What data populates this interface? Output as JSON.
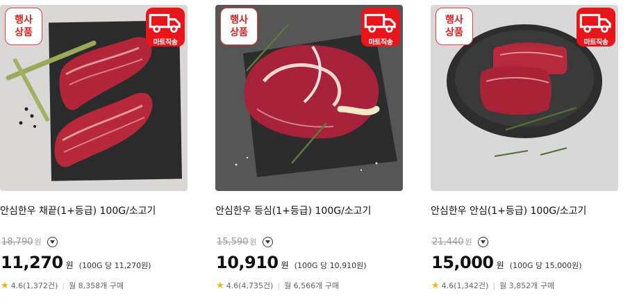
{
  "colors": {
    "accent_red": "#e8151b",
    "star": "#f5b301",
    "price": "#111111",
    "muted": "#999999"
  },
  "products": [
    {
      "event_badge": [
        "행사",
        "상품"
      ],
      "delivery_badge": "마트직송",
      "title": "안심한우 채끝(1+등급) 100G/소고기",
      "original_price": "18,790",
      "original_unit": "원",
      "price": "11,270",
      "price_unit": "원",
      "unit_price": "(100G 당 11,270원)",
      "rating": "4.6(1,372건)",
      "monthly_sales": "월 8,358개 구매"
    },
    {
      "event_badge": [
        "행사",
        "상품"
      ],
      "delivery_badge": "마트직송",
      "title": "안심한우 등심(1+등급) 100G/소고기",
      "original_price": "15,590",
      "original_unit": "원",
      "price": "10,910",
      "price_unit": "원",
      "unit_price": "(100G 당 10,910원)",
      "rating": "4.6(4,735건)",
      "monthly_sales": "월 6,566개 구매"
    },
    {
      "event_badge": [
        "행사",
        "상품"
      ],
      "delivery_badge": "마트직송",
      "title": "안심한우 안심(1+등급) 100G/소고기",
      "original_price": "21,440",
      "original_unit": "원",
      "price": "15,000",
      "price_unit": "원",
      "unit_price": "(100G 당 15,000원)",
      "rating": "4.6(1,342건)",
      "monthly_sales": "월 3,852개 구매"
    }
  ],
  "icons": {
    "delivery": "truck-icon",
    "dropdown": "chevron-down-icon",
    "rating": "star-icon"
  }
}
